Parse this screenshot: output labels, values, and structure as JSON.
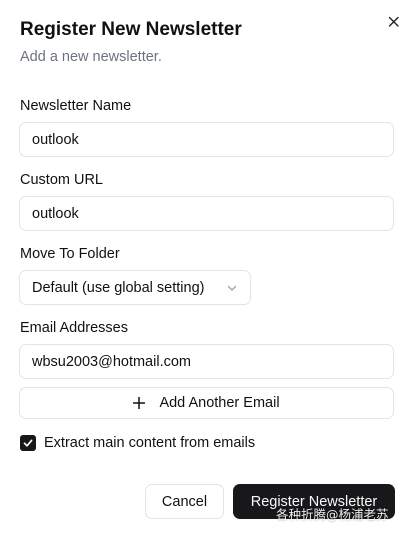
{
  "dialog": {
    "title": "Register New Newsletter",
    "subtitle": "Add a new newsletter.",
    "close_icon": "close-icon"
  },
  "form": {
    "name_label": "Newsletter Name",
    "name_value": "outlook",
    "url_label": "Custom URL",
    "url_value": "outlook",
    "folder_label": "Move To Folder",
    "folder_value": "Default (use global setting)",
    "emails_label": "Email Addresses",
    "email_value": "wbsu2003@hotmail.com",
    "add_email_label": "Add Another Email",
    "add_email_icon": "plus-icon",
    "extract_label": "Extract main content from emails",
    "extract_checked": true
  },
  "actions": {
    "cancel_label": "Cancel",
    "register_label": "Register Newsletter"
  },
  "watermark": "各种折腾@杨浦老苏",
  "colors": {
    "primary": "#18181b",
    "muted_text": "#6b7280",
    "border": "#e4e4e7"
  }
}
